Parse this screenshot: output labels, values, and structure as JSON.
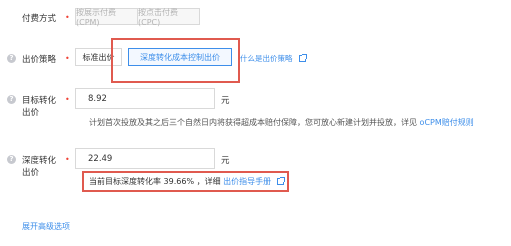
{
  "billing": {
    "label": "付费方式",
    "options": [
      "按展示付费(CPM)",
      "按点击付费(CPC)"
    ]
  },
  "strategy": {
    "label": "出价策略",
    "options": [
      "标准出价",
      "深度转化成本控制出价"
    ],
    "help_link": "什么是出价策略"
  },
  "target_cost": {
    "label_line1": "目标转化",
    "label_line2": "出价",
    "value": "8.92",
    "unit": "元",
    "desc_prefix": "计划首次投放及其之后三个自然日内将获得超成本赔付保障，您可放心新建计划并投放，详见",
    "desc_link": "oCPM赔付规则"
  },
  "deep_cost": {
    "label_line1": "深度转化",
    "label_line2": "出价",
    "value": "22.49",
    "unit": "元",
    "rate_text": "当前目标深度转化率 39.66% ，详细",
    "rate_link": "出价指导手册"
  },
  "advanced_link": "展开高级选项",
  "colors": {
    "accent": "#3d8eea",
    "required": "#f04134",
    "highlight_box": "#e05a4f"
  }
}
